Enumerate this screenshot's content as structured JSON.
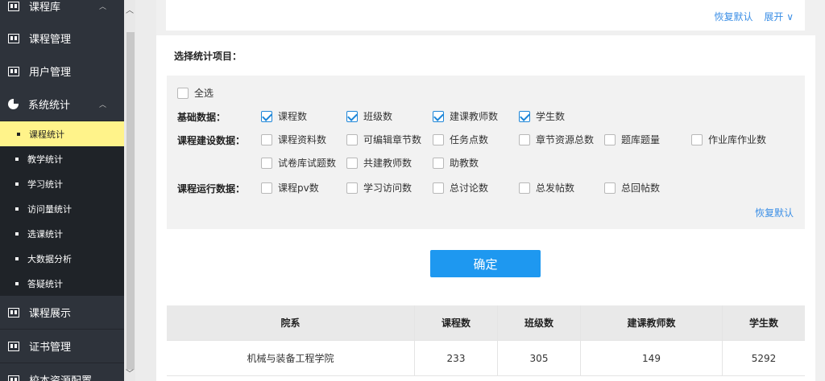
{
  "sidebar": {
    "items": [
      {
        "label": "课程库",
        "type": "group",
        "caret": "^"
      },
      {
        "label": "课程管理",
        "type": "item"
      },
      {
        "label": "用户管理",
        "type": "item"
      },
      {
        "label": "系统统计",
        "type": "group",
        "caret": "^"
      },
      {
        "label": "课程展示",
        "type": "item"
      },
      {
        "label": "证书管理",
        "type": "item"
      },
      {
        "label": "校本资源配置",
        "type": "item"
      }
    ],
    "sub_items": [
      "课程统计",
      "教学统计",
      "学习统计",
      "访问量统计",
      "选课统计",
      "大数据分析",
      "答疑统计"
    ],
    "active_sub": "课程统计",
    "active_color": "#fff38a"
  },
  "topbar": {
    "restore_label": "恢复默认",
    "expand_label": "展开 ∨"
  },
  "select": {
    "title": "选择统计项目：",
    "select_all": "全选",
    "rows": [
      {
        "label": "基础数据：",
        "options": [
          {
            "text": "课程数",
            "checked": true
          },
          {
            "text": "班级数",
            "checked": true
          },
          {
            "text": "建课教师数",
            "checked": true
          },
          {
            "text": "学生数",
            "checked": true
          }
        ]
      },
      {
        "label": "课程建设数据：",
        "options": [
          {
            "text": "课程资料数",
            "checked": false
          },
          {
            "text": "可编辑章节数",
            "checked": false
          },
          {
            "text": "任务点数",
            "checked": false
          },
          {
            "text": "章节资源总数",
            "checked": false
          },
          {
            "text": "题库题量",
            "checked": false
          },
          {
            "text": "作业库作业数",
            "checked": false
          },
          {
            "text": "试卷库试题数",
            "checked": false
          },
          {
            "text": "共建教师数",
            "checked": false
          },
          {
            "text": "助教数",
            "checked": false
          }
        ]
      },
      {
        "label": "课程运行数据：",
        "options": [
          {
            "text": "课程pv数",
            "checked": false
          },
          {
            "text": "学习访问数",
            "checked": false
          },
          {
            "text": "总讨论数",
            "checked": false
          },
          {
            "text": "总发帖数",
            "checked": false
          },
          {
            "text": "总回帖数",
            "checked": false
          }
        ]
      }
    ],
    "restore_label": "恢复默认",
    "confirm_label": "确定"
  },
  "table": {
    "headers": [
      "院系",
      "课程数",
      "班级数",
      "建课教师数",
      "学生数"
    ],
    "rows": [
      [
        "机械与装备工程学院",
        "233",
        "305",
        "149",
        "5292"
      ]
    ]
  },
  "colors": {
    "accent": "#1e98f0",
    "link": "#3a8ee6",
    "sidebar": "#2e333b"
  }
}
